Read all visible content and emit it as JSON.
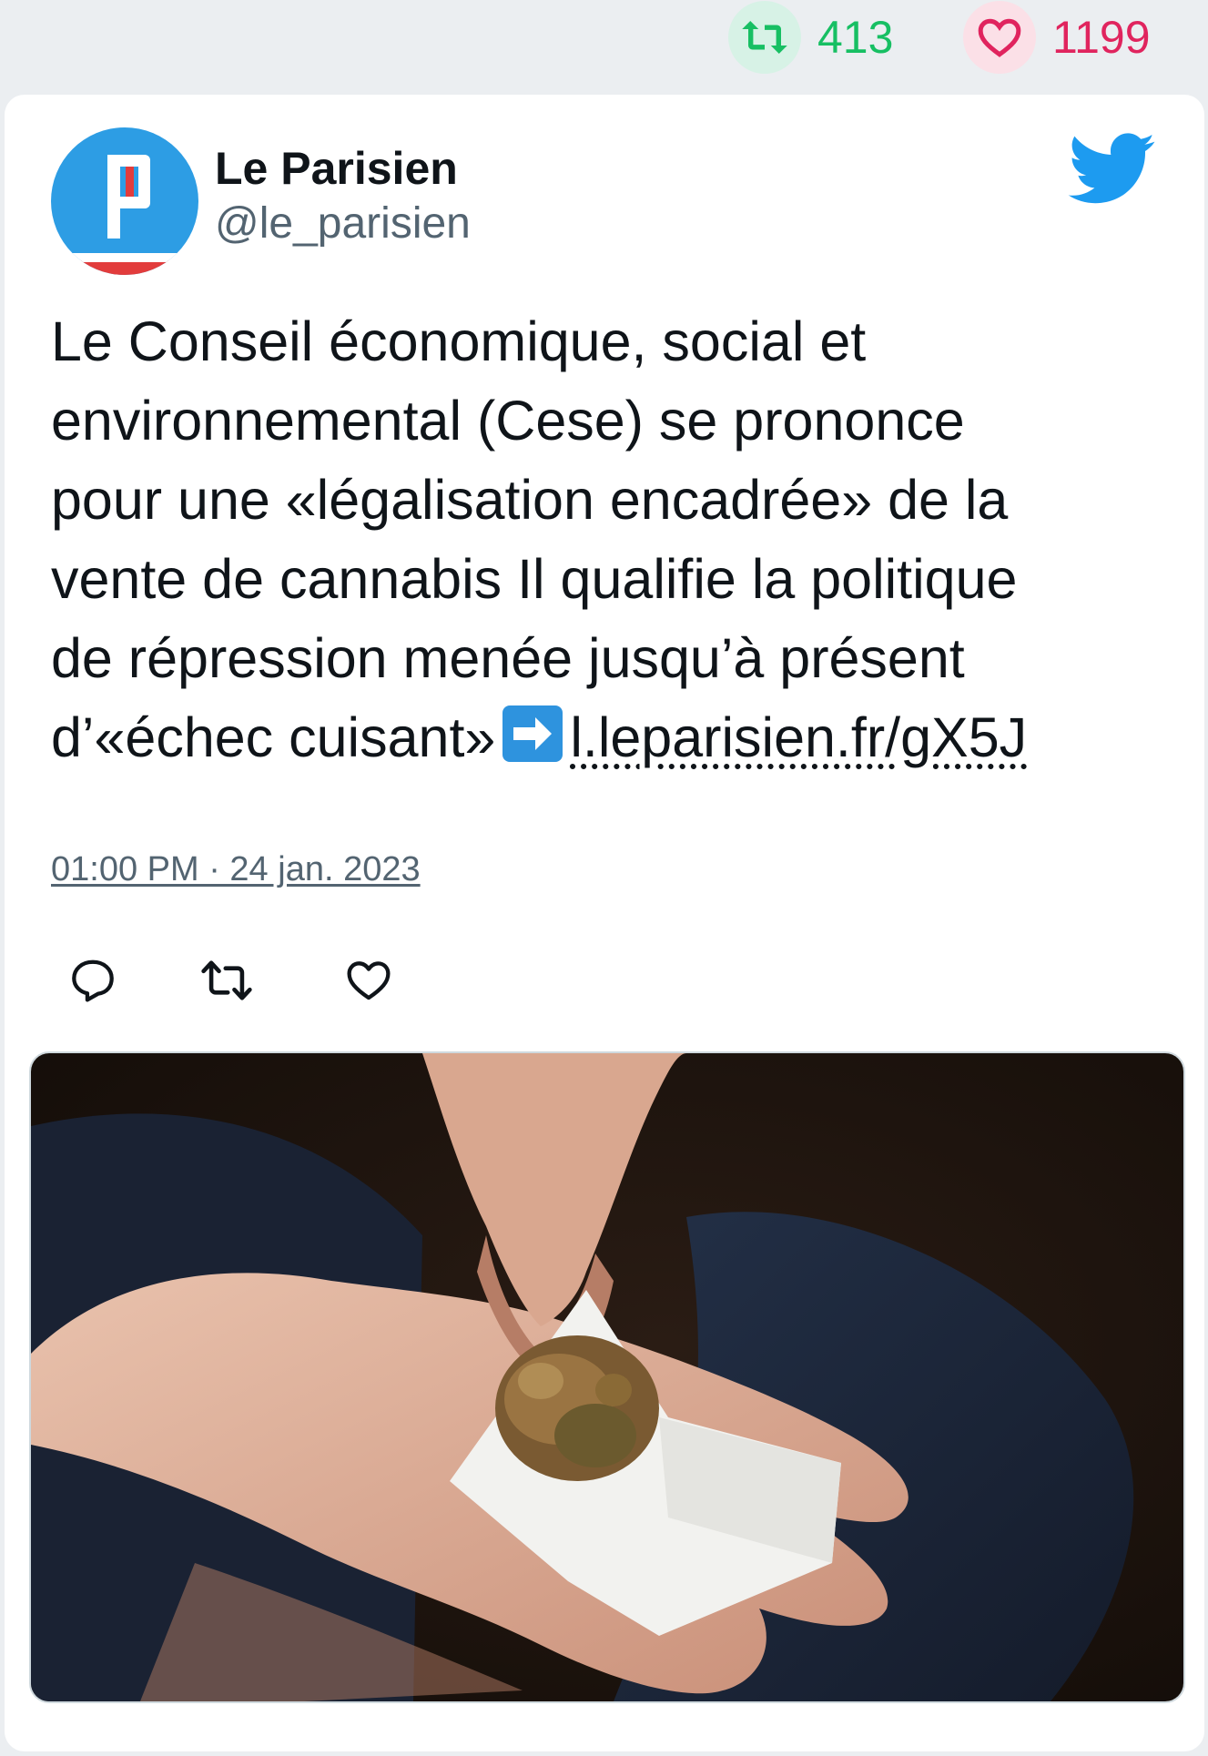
{
  "stats": {
    "retweets": "413",
    "likes": "1199",
    "retweet_color": "#17bf63",
    "like_color": "#e0245e"
  },
  "author": {
    "name": "Le Parisien",
    "handle": "@le_parisien",
    "avatar_letter": "P",
    "avatar_color": "#2d9de4"
  },
  "tweet": {
    "text": "Le Conseil économique, social et\nenvironnemental (Cese) se prononce\npour une «légalisation encadrée» de la\nvente de cannabis Il qualifie la politique\nde répression menée jusqu’à présent\nd’«échec cuisant»",
    "link": "l.leparisien.fr/gX5J",
    "timestamp": "01:00 PM · 24 jan. 2023"
  },
  "icons": {
    "retweet": "retweet-icon",
    "like": "heart-icon",
    "reply": "reply-icon",
    "brand": "twitter-bird-icon",
    "arrow": "right-arrow-emoji-icon"
  },
  "media": {
    "alt": ""
  }
}
